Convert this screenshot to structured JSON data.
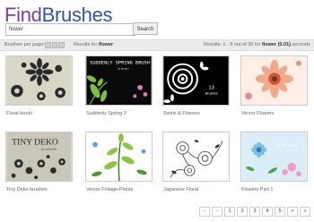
{
  "logo": {
    "part1": "Find",
    "part2": "Brushes"
  },
  "search": {
    "value": "flower",
    "button": "Search"
  },
  "bar": {
    "perpage_label": "Brushes per page:",
    "results_label": "Results for",
    "query": "flower",
    "count_prefix": "Results: 1 - 8 out of 39 for",
    "time": "(0.01)",
    "count_suffix": "seconds"
  },
  "results": [
    {
      "caption": "Floral brush"
    },
    {
      "caption": "Suddenly Spring 2"
    },
    {
      "caption": "Swirls & Flowers"
    },
    {
      "caption": "Vector Flowers"
    },
    {
      "caption": "Tiny Deko brushes"
    },
    {
      "caption": "Vector Foliage-Plants"
    },
    {
      "caption": "Japanese Floral"
    },
    {
      "caption": "Flowers Part 1"
    }
  ],
  "thumb_text": {
    "suddenly": "SUDDENLY SPRING BRUSH",
    "suddenly_sub": "by gbright",
    "swirls": "13",
    "swirls_sub": "Brushes",
    "tiny": "TINY DEKO",
    "tiny_sub": "by mahnoelle",
    "flowers": "11 brushes",
    "flowers_sub": "by aikon"
  },
  "pager": {
    "first": "«",
    "prev": "<",
    "pages": [
      "1",
      "2",
      "3",
      "4",
      "5"
    ],
    "next": ">",
    "last": "»"
  },
  "colors": {
    "logo_purple": "#7a3f9a",
    "logo_blue": "#2f55a4",
    "bar_bg": "#ebebeb"
  }
}
